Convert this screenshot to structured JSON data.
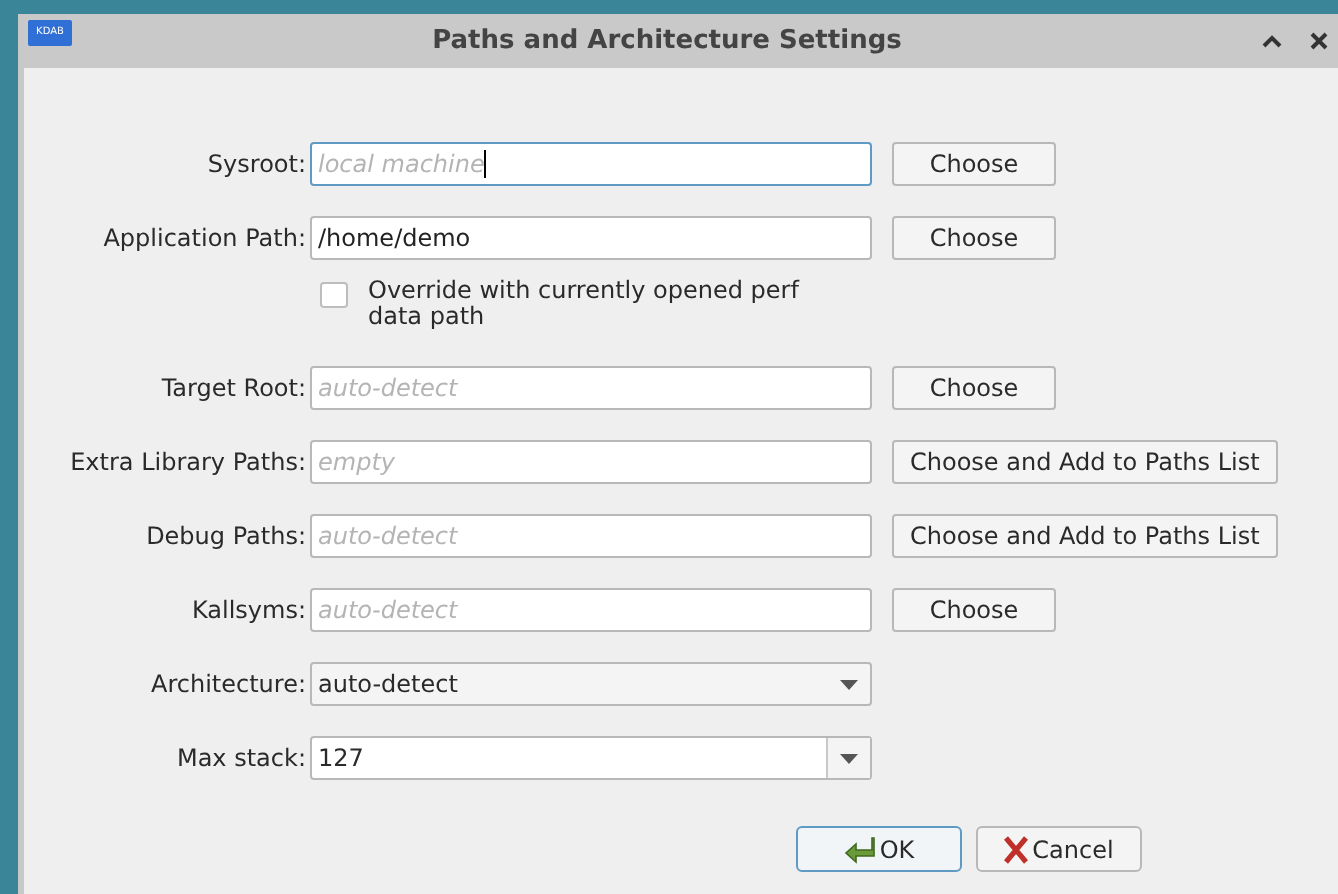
{
  "window": {
    "logo": "KDAB",
    "title": "Paths and Architecture Settings"
  },
  "rows": [
    {
      "kind": "field",
      "label": "Sysroot:",
      "placeholder": "local machine",
      "focused": true,
      "button": "Choose"
    },
    {
      "kind": "field",
      "label": "Application Path:",
      "value": "/home/demo",
      "focused": false,
      "button": "Choose"
    },
    {
      "kind": "checkbox",
      "label": "Override with currently opened perf data path",
      "checked": false
    },
    {
      "kind": "field",
      "label": "Target Root:",
      "placeholder": "auto-detect",
      "focused": false,
      "button": "Choose"
    },
    {
      "kind": "field",
      "label": "Extra Library Paths:",
      "placeholder": "empty",
      "focused": false,
      "button": "Choose and Add to Paths List"
    },
    {
      "kind": "field",
      "label": "Debug Paths:",
      "placeholder": "auto-detect",
      "focused": false,
      "button": "Choose and Add to Paths List"
    },
    {
      "kind": "field",
      "label": "Kallsyms:",
      "placeholder": "auto-detect",
      "focused": false,
      "button": "Choose"
    },
    {
      "kind": "combo",
      "label": "Architecture:",
      "value": "auto-detect"
    },
    {
      "kind": "editable-combo",
      "label": "Max stack:",
      "value": "127"
    }
  ],
  "buttons": [
    {
      "kind": "ok",
      "label": "OK"
    },
    {
      "kind": "cancel",
      "label": "Cancel"
    }
  ]
}
